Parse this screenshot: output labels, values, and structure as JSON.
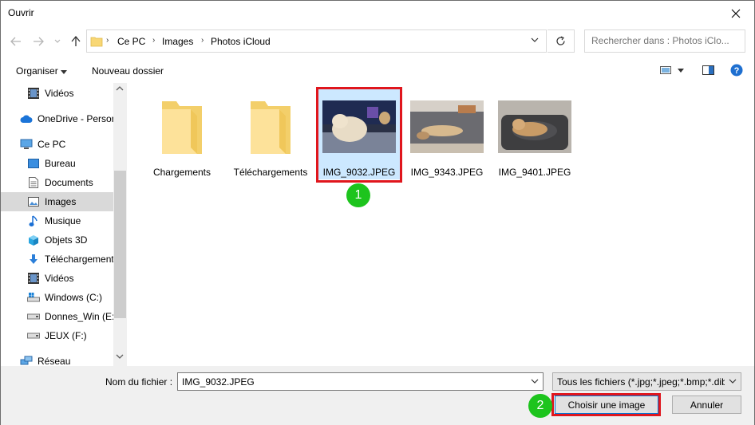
{
  "window": {
    "title": "Ouvrir"
  },
  "address": {
    "crumbs": [
      "Ce PC",
      "Images",
      "Photos iCloud"
    ]
  },
  "search": {
    "placeholder": "Rechercher dans : Photos iClo..."
  },
  "toolbar": {
    "organize_label": "Organiser",
    "new_folder_label": "Nouveau dossier"
  },
  "sidebar": {
    "items": [
      {
        "label": "Vidéos",
        "icon": "video-icon"
      },
      {
        "label": "OneDrive - Person",
        "icon": "cloud-icon"
      },
      {
        "label": "Ce PC",
        "icon": "computer-icon"
      },
      {
        "label": "Bureau",
        "icon": "desktop-icon"
      },
      {
        "label": "Documents",
        "icon": "document-icon"
      },
      {
        "label": "Images",
        "icon": "images-icon",
        "selected": true
      },
      {
        "label": "Musique",
        "icon": "music-icon"
      },
      {
        "label": "Objets 3D",
        "icon": "cube-icon"
      },
      {
        "label": "Téléchargements",
        "icon": "download-icon"
      },
      {
        "label": "Vidéos",
        "icon": "video-icon"
      },
      {
        "label": "Windows (C:)",
        "icon": "drive-icon"
      },
      {
        "label": "Donnes_Win (E:)",
        "icon": "drive-icon"
      },
      {
        "label": "JEUX (F:)",
        "icon": "drive-icon"
      },
      {
        "label": "Réseau",
        "icon": "network-icon"
      }
    ]
  },
  "files": [
    {
      "name": "Chargements",
      "kind": "folder"
    },
    {
      "name": "Téléchargements",
      "kind": "folder"
    },
    {
      "name": "IMG_9032.JPEG",
      "kind": "photo",
      "selected": true
    },
    {
      "name": "IMG_9343.JPEG",
      "kind": "photo"
    },
    {
      "name": "IMG_9401.JPEG",
      "kind": "photo"
    }
  ],
  "annotations": {
    "step1": "1",
    "step2": "2",
    "highlight_color": "#e0161d",
    "badge_color": "#1dc41d"
  },
  "bottom": {
    "filename_label": "Nom du fichier :",
    "filename_value": "IMG_9032.JPEG",
    "filetype": "Tous les fichiers (*.jpg;*.jpeg;*.bmp;*.dib",
    "open_label": "Choisir une image",
    "cancel_label": "Annuler"
  }
}
